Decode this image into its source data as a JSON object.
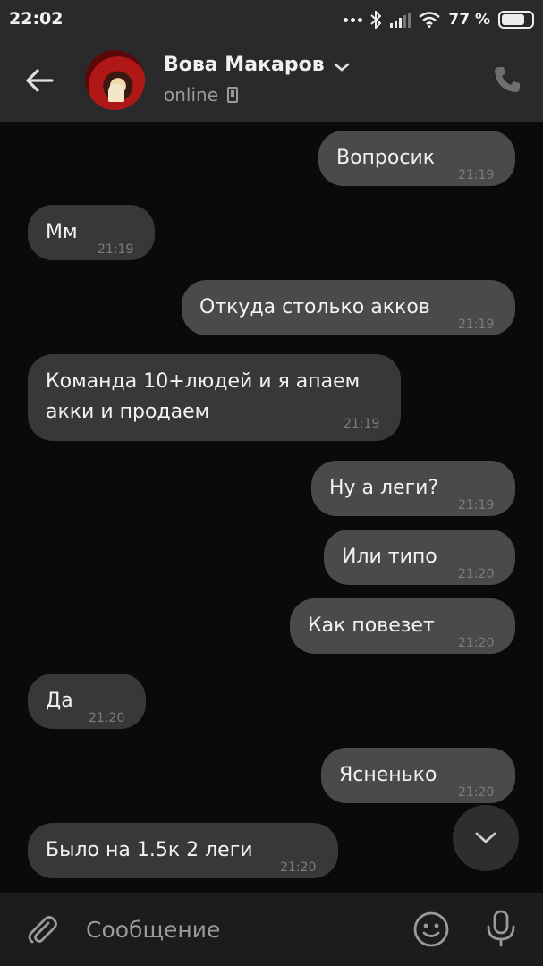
{
  "status_bar": {
    "time": "22:02",
    "battery": "77 %",
    "battery_level": 0.77
  },
  "header": {
    "contact_name": "Вова Макаров",
    "status": "online"
  },
  "messages": [
    {
      "direction": "out",
      "text": "Вопросик",
      "time": "21:19"
    },
    {
      "direction": "in",
      "text": "Мм",
      "time": "21:19"
    },
    {
      "direction": "out",
      "text": "Откуда столько акков",
      "time": "21:19"
    },
    {
      "direction": "in",
      "text": "Команда 10+людей и я апаем\nакки и продаем",
      "time": "21:19"
    },
    {
      "direction": "out",
      "text": "Ну а леги?",
      "time": "21:19"
    },
    {
      "direction": "out",
      "text": "Или типо",
      "time": "21:20"
    },
    {
      "direction": "out",
      "text": "Как повезет",
      "time": "21:20"
    },
    {
      "direction": "in",
      "text": "Да",
      "time": "21:20"
    },
    {
      "direction": "out",
      "text": "Ясненько",
      "time": "21:20"
    },
    {
      "direction": "in",
      "text": "Было на 1.5к 2 леги",
      "time": "21:20"
    }
  ],
  "composer": {
    "placeholder": "Сообщение"
  },
  "icons": {
    "back": "arrow-left-icon",
    "call": "phone-icon",
    "attach": "paperclip-icon",
    "emoji": "smiley-icon",
    "mic": "microphone-icon",
    "scroll": "chevron-down-icon"
  }
}
